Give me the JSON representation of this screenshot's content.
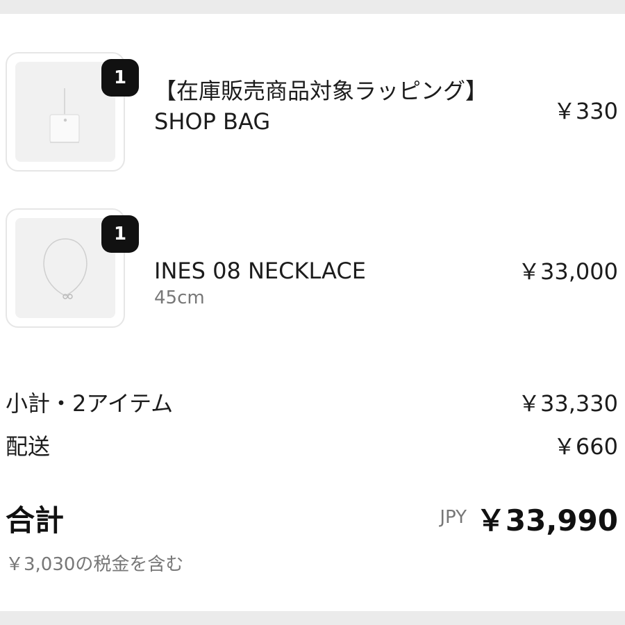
{
  "items": [
    {
      "quantity": "1",
      "name": "【在庫販売商品対象ラッピング】SHOP BAG",
      "variant": "",
      "price": "￥330",
      "image": "shop-bag-image"
    },
    {
      "quantity": "1",
      "name": "INES 08 NECKLACE",
      "variant": "45cm",
      "price": "￥33,000",
      "image": "necklace-image"
    }
  ],
  "summary": {
    "subtotal_label": "小計・2アイテム",
    "subtotal_value": "￥33,330",
    "shipping_label": "配送",
    "shipping_value": "￥660",
    "total_label": "合計",
    "currency": "JPY",
    "total_value": "￥33,990",
    "tax_note": "￥3,030の税金を含む"
  }
}
